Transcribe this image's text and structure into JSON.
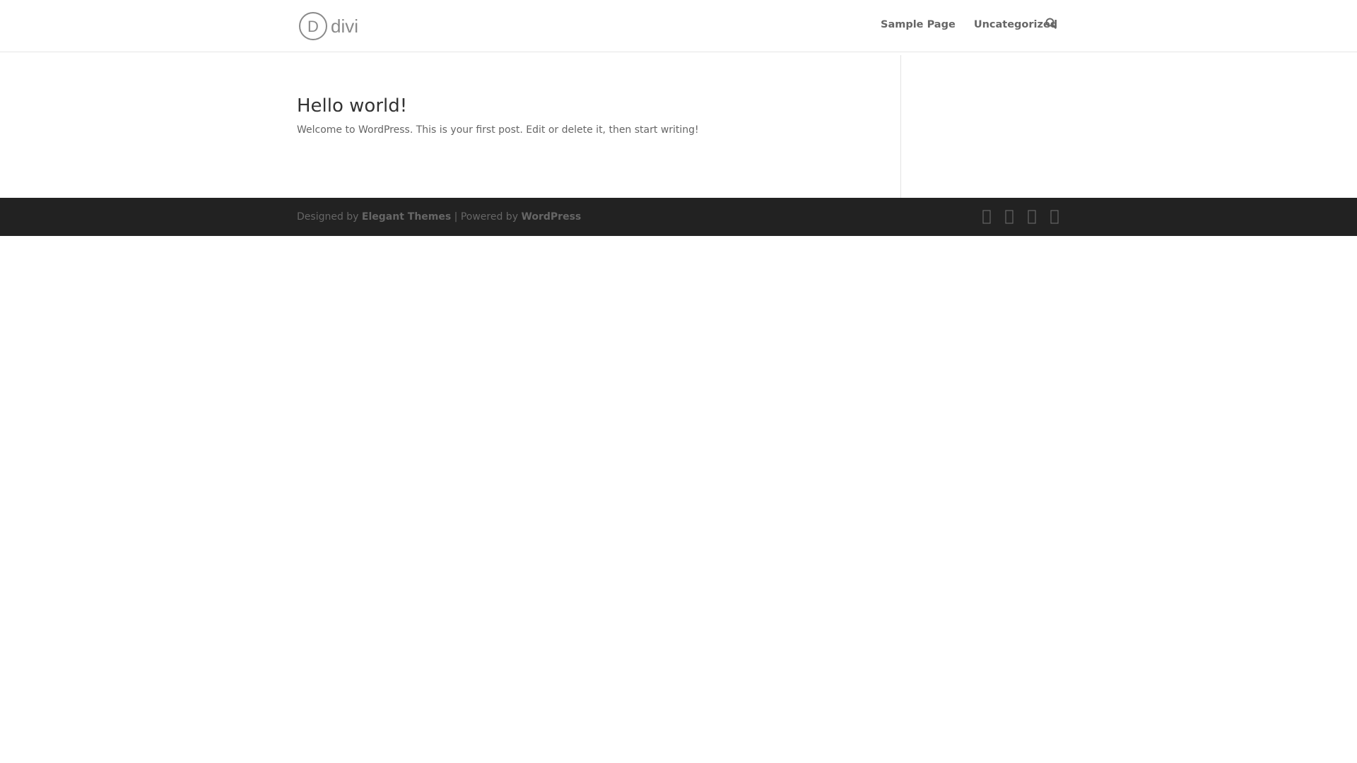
{
  "header": {
    "logo_text": "divi",
    "logo_mark": "D",
    "nav": [
      {
        "label": "Sample Page"
      },
      {
        "label": "Uncategorized"
      }
    ],
    "search_icon": "search-icon"
  },
  "post": {
    "title": "Hello world!",
    "excerpt": "Welcome to WordPress. This is your first post. Edit or delete it, then start writing!"
  },
  "footer": {
    "designed_by": "Designed by ",
    "designer": "Elegant Themes",
    "separator": " | Powered by ",
    "platform": "WordPress",
    "social_icons": [
      "facebook-icon",
      "twitter-icon",
      "google-plus-icon",
      "rss-icon"
    ]
  },
  "colors": {
    "header_bg": "#ffffff",
    "footer_bg": "#222222",
    "text": "#666666",
    "title": "#333333",
    "divider": "#e2e2e2"
  }
}
